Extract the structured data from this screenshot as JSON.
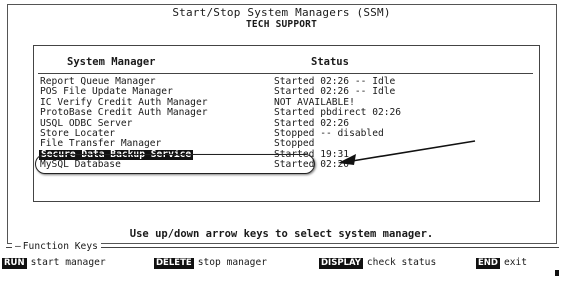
{
  "window": {
    "title": "Start/Stop System Managers (SSM)",
    "subtitle": "TECH SUPPORT"
  },
  "table": {
    "headers": {
      "manager": "System Manager",
      "status": "Status"
    },
    "rows": [
      {
        "name": "Report Queue Manager",
        "status": "Started 02:26 -- Idle"
      },
      {
        "name": "POS File Update Manager",
        "status": "Started 02:26 -- Idle"
      },
      {
        "name": "IC Verify Credit Auth Manager",
        "status": "NOT AVAILABLE!"
      },
      {
        "name": "ProtoBase Credit Auth Manager",
        "status": "Started pbdirect 02:26"
      },
      {
        "name": "USQL ODBC Server",
        "status": "Started 02:26"
      },
      {
        "name": "Store Locater",
        "status": "Stopped -- disabled"
      },
      {
        "name": "File Transfer Manager",
        "status": "Stopped"
      },
      {
        "name": "Secure Data Backup Service",
        "status": "Started 19:31"
      },
      {
        "name": "MySQL Database",
        "status": "Started 02:20"
      }
    ],
    "selected_index": 7
  },
  "hint": "Use up/down arrow keys to select system manager.",
  "function_keys": {
    "title": "Function Keys",
    "items": [
      {
        "key": "RUN",
        "label": "start manager"
      },
      {
        "key": "DELETE",
        "label": "stop manager"
      },
      {
        "key": "DISPLAY",
        "label": "check status"
      },
      {
        "key": "END",
        "label": "exit"
      }
    ]
  },
  "annotation": {
    "arrow_icon": "arrow-left-icon",
    "oval": "highlight-oval"
  }
}
